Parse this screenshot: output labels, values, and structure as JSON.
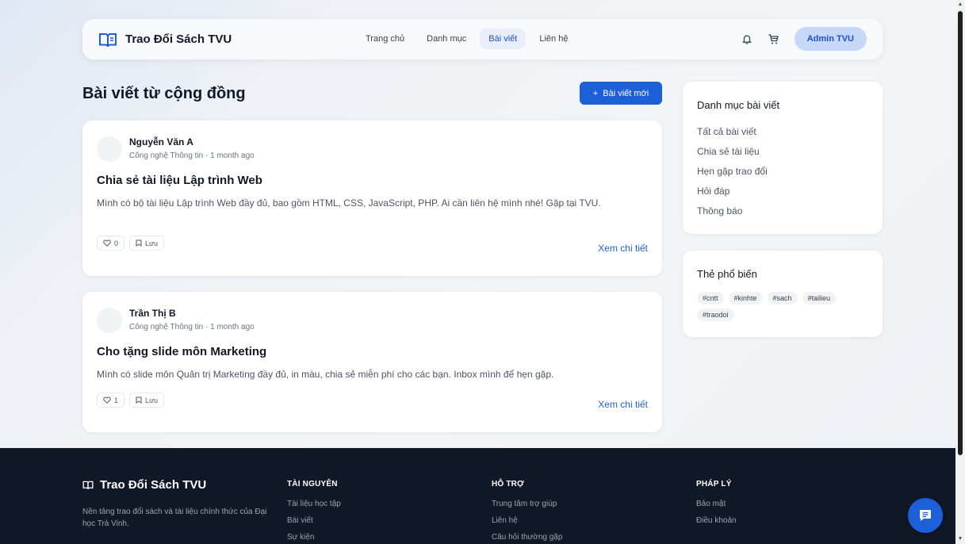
{
  "colors": {
    "accent": "#1d5fd8",
    "footer_bg": "#111827",
    "admin_bg": "#c7d7f7"
  },
  "header": {
    "brand": "Trao Đổi Sách TVU",
    "nav": [
      {
        "label": "Trang chủ"
      },
      {
        "label": "Danh mục"
      },
      {
        "label": "Bài viết",
        "active": true
      },
      {
        "label": "Liên hệ"
      }
    ],
    "icons": [
      "bell-icon",
      "cart-icon"
    ],
    "admin_label": "Admin TVU"
  },
  "main": {
    "title": "Bài viết từ cộng đồng",
    "new_post_label": "Bài viết mới",
    "posts": [
      {
        "author": "Nguyễn Văn A",
        "meta": "Công nghệ Thông tin · 1 month ago",
        "title": "Chia sẻ tài liệu Lập trình Web",
        "body": "Mình có bộ tài liệu Lập trình Web đầy đủ, bao gồm HTML, CSS, JavaScript, PHP. Ai cần liên hệ mình nhé! Gặp tại TVU.",
        "likes": "0",
        "save_label": "Lưu",
        "detail_label": "Xem chi tiết"
      },
      {
        "author": "Trần Thị B",
        "meta": "Công nghệ Thông tin · 1 month ago",
        "title": "Cho tặng slide môn Marketing",
        "body": "Mình có slide môn Quản trị Marketing đầy đủ, in màu, chia sẻ miễn phí cho các bạn. Inbox mình để hẹn gặp.",
        "likes": "1",
        "save_label": "Lưu",
        "detail_label": "Xem chi tiết"
      }
    ]
  },
  "sidebar": {
    "categories_title": "Danh mục bài viết",
    "categories": [
      {
        "label": "Tất cả bài viết"
      },
      {
        "label": "Chia sẻ tài liệu"
      },
      {
        "label": "Hẹn gặp trao đổi"
      },
      {
        "label": "Hỏi đáp"
      },
      {
        "label": "Thông báo"
      }
    ],
    "tags_title": "Thẻ phổ biến",
    "tags": [
      {
        "label": "#cntt"
      },
      {
        "label": "#kinhte"
      },
      {
        "label": "#sach"
      },
      {
        "label": "#tailieu"
      },
      {
        "label": "#traodoi"
      }
    ]
  },
  "footer": {
    "brand": "Trao Đổi Sách TVU",
    "description": "Nền tảng trao đổi sách và tài liệu chính thức của Đại học Trà Vinh.",
    "columns": [
      {
        "heading": "TÀI NGUYÊN",
        "links": [
          "Tài liệu học tập",
          "Bài viết",
          "Sự kiện"
        ]
      },
      {
        "heading": "HỖ TRỢ",
        "links": [
          "Trung tâm trợ giúp",
          "Liên hệ",
          "Câu hỏi thường gặp"
        ]
      },
      {
        "heading": "PHÁP LÝ",
        "links": [
          "Bảo mật",
          "Điều khoản"
        ]
      }
    ]
  }
}
